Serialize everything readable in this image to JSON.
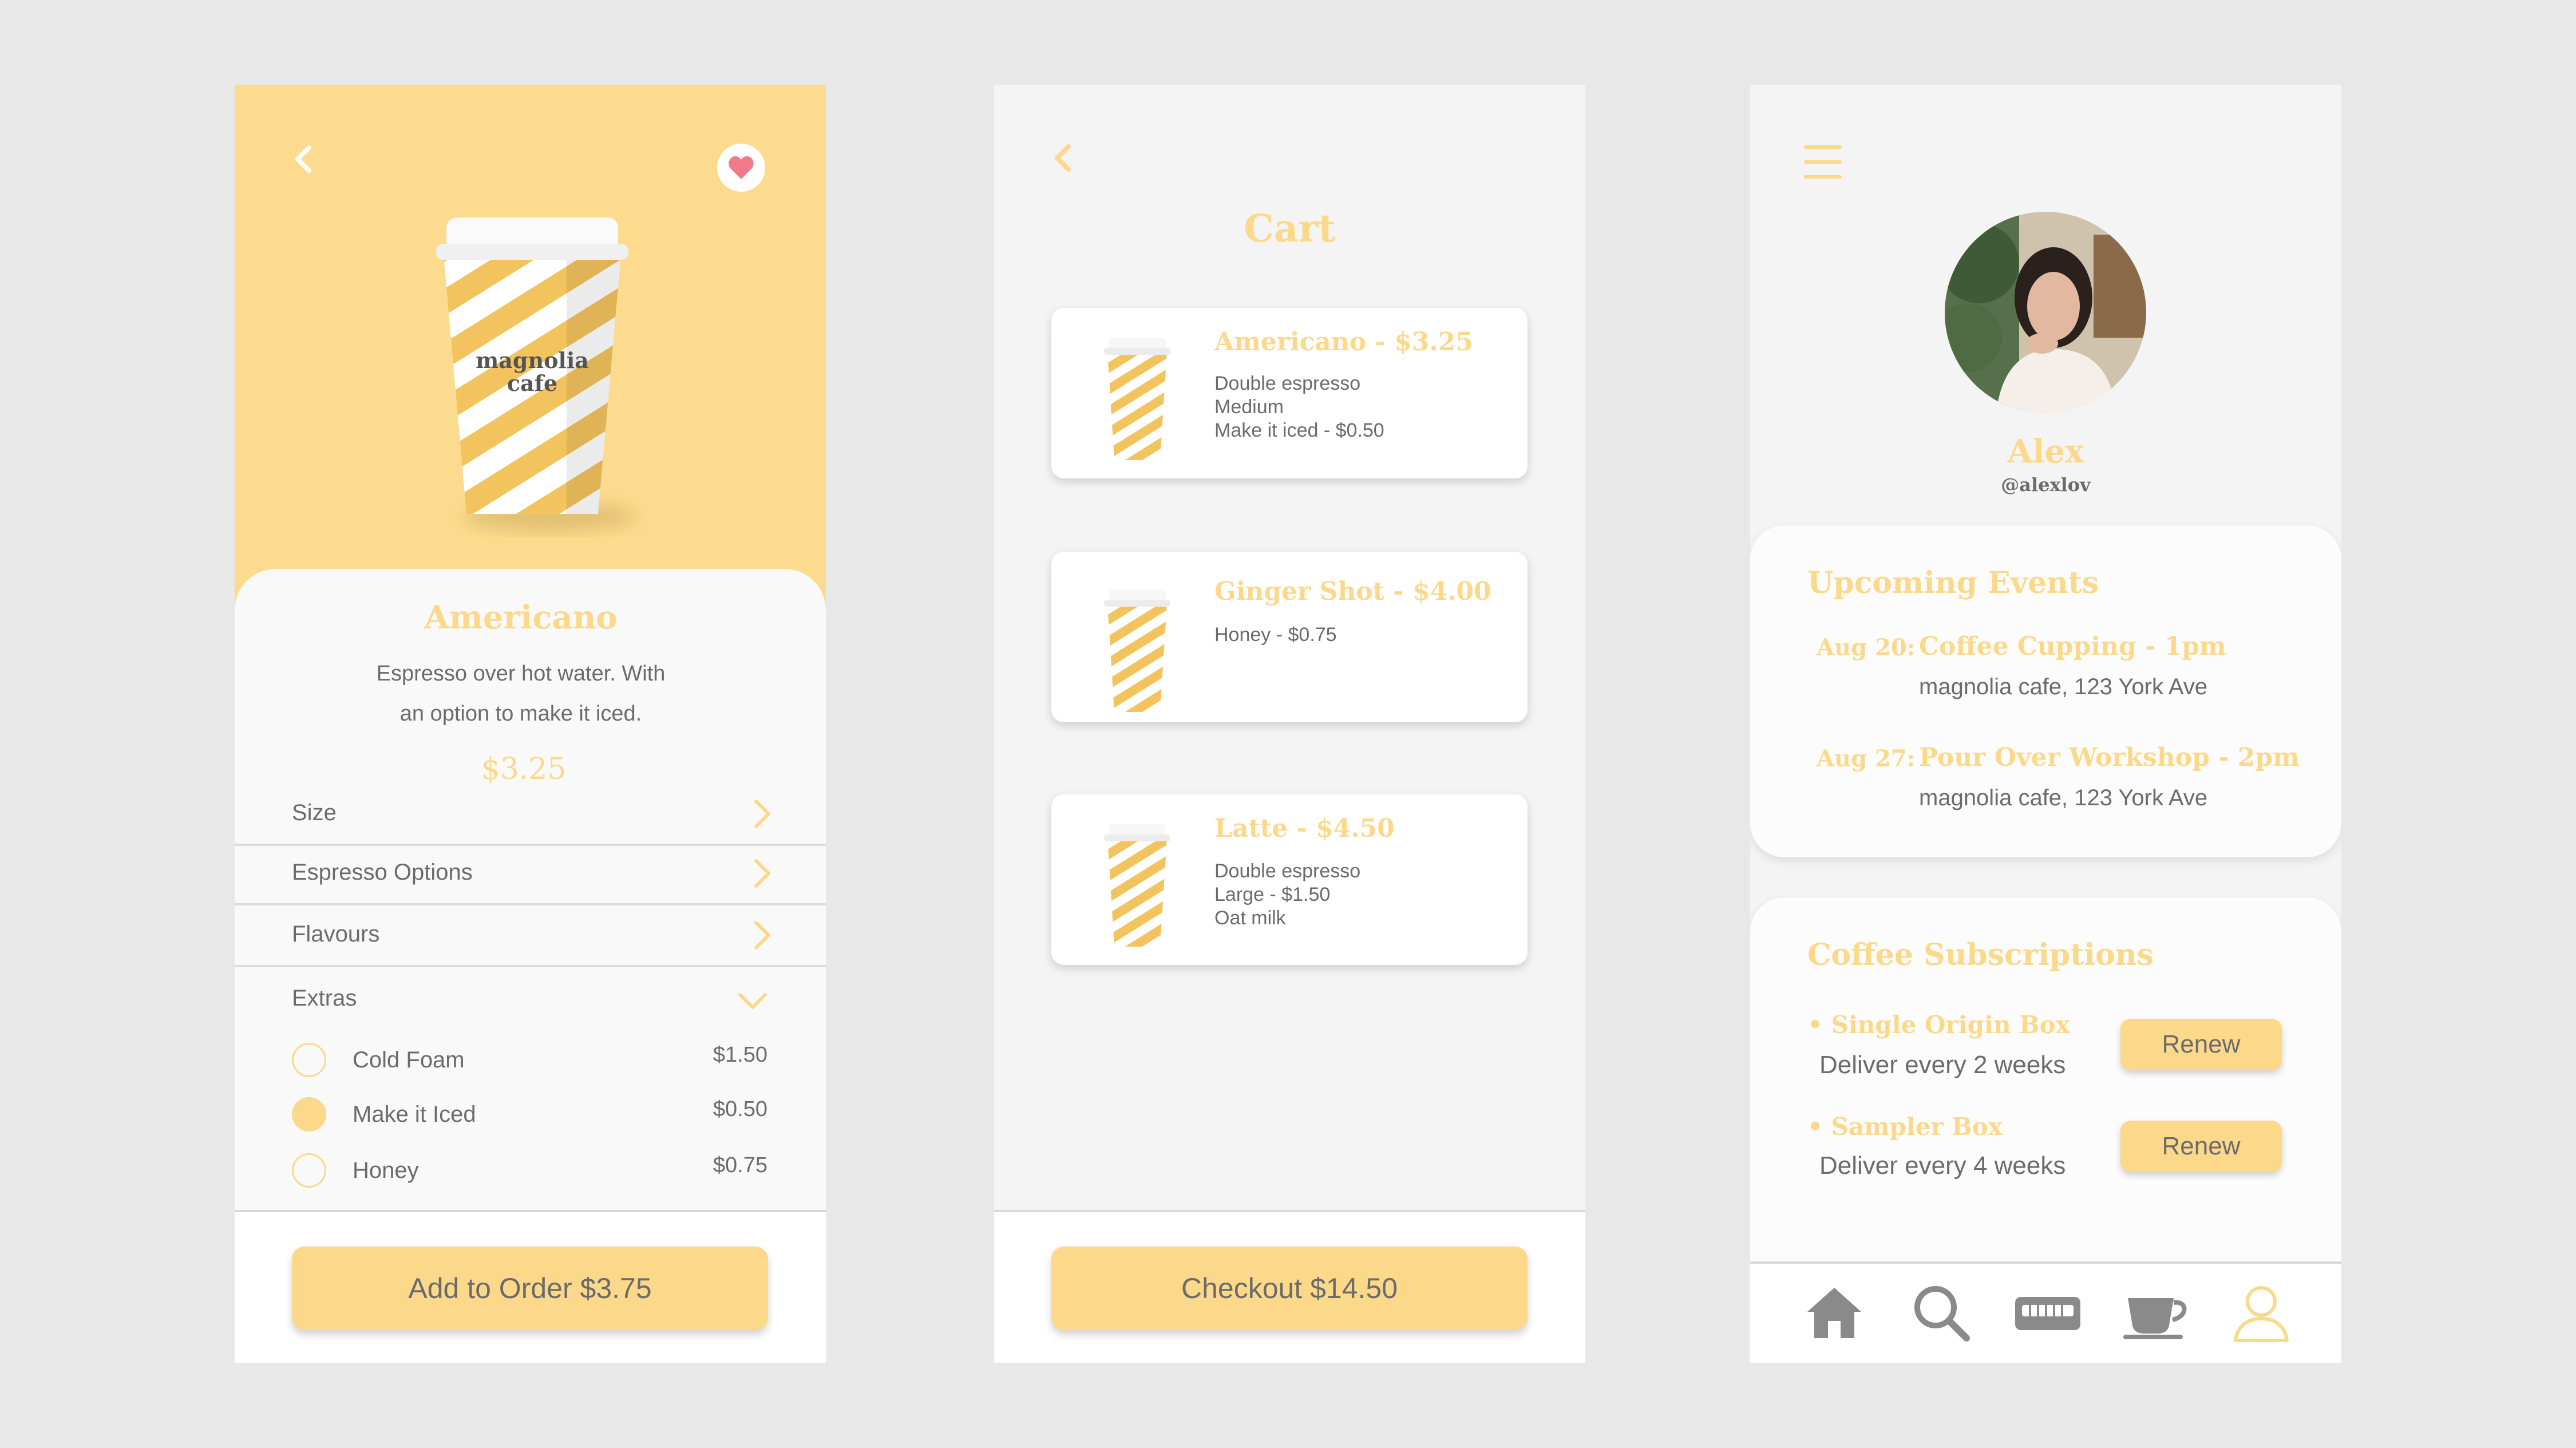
{
  "colors": {
    "accent": "#fcd88a",
    "background": "#e8e8e8",
    "text": "#6b6b6b",
    "heart": "#f07a8a"
  },
  "product": {
    "cup_logo_line1": "magnolia",
    "cup_logo_line2": "cafe",
    "name": "Americano",
    "description_line1": "Espresso over hot water. With",
    "description_line2": "an option to make it iced.",
    "price": "$3.25",
    "options": [
      {
        "label": "Size"
      },
      {
        "label": "Espresso Options"
      },
      {
        "label": "Flavours"
      },
      {
        "label": "Extras"
      }
    ],
    "extras": [
      {
        "name": "Cold Foam",
        "price": "$1.50",
        "selected": false
      },
      {
        "name": "Make it Iced",
        "price": "$0.50",
        "selected": true
      },
      {
        "name": "Honey",
        "price": "$0.75",
        "selected": false
      }
    ],
    "add_button": "Add to Order $3.75"
  },
  "cart": {
    "title": "Cart",
    "items": [
      {
        "title": "Americano - $3.25",
        "lines": [
          "Double espresso",
          "Medium",
          "Make it  iced - $0.50"
        ]
      },
      {
        "title": "Ginger Shot - $4.00",
        "lines": [
          "Honey - $0.75"
        ]
      },
      {
        "title": "Latte - $4.50",
        "lines": [
          "Double espresso",
          "Large - $1.50",
          "Oat milk"
        ]
      }
    ],
    "checkout_button": "Checkout $14.50"
  },
  "profile": {
    "name": "Alex",
    "handle": "@alexlov",
    "events_title": "Upcoming Events",
    "events": [
      {
        "date": "Aug 20:",
        "title": "Coffee Cupping - 1pm",
        "location": "magnolia cafe, 123 York Ave"
      },
      {
        "date": "Aug 27:",
        "title": "Pour Over Workshop - 2pm",
        "location": "magnolia cafe, 123 York Ave"
      }
    ],
    "subscriptions_title": "Coffee Subscriptions",
    "subscriptions": [
      {
        "name": "• Single Origin Box",
        "desc": "Deliver every 2 weeks",
        "button": "Renew"
      },
      {
        "name": "• Sampler Box",
        "desc": "Deliver every 4 weeks",
        "button": "Renew"
      }
    ],
    "tabs": [
      "home-icon",
      "search-icon",
      "menu-card-icon",
      "coffee-cup-icon",
      "user-icon"
    ]
  }
}
